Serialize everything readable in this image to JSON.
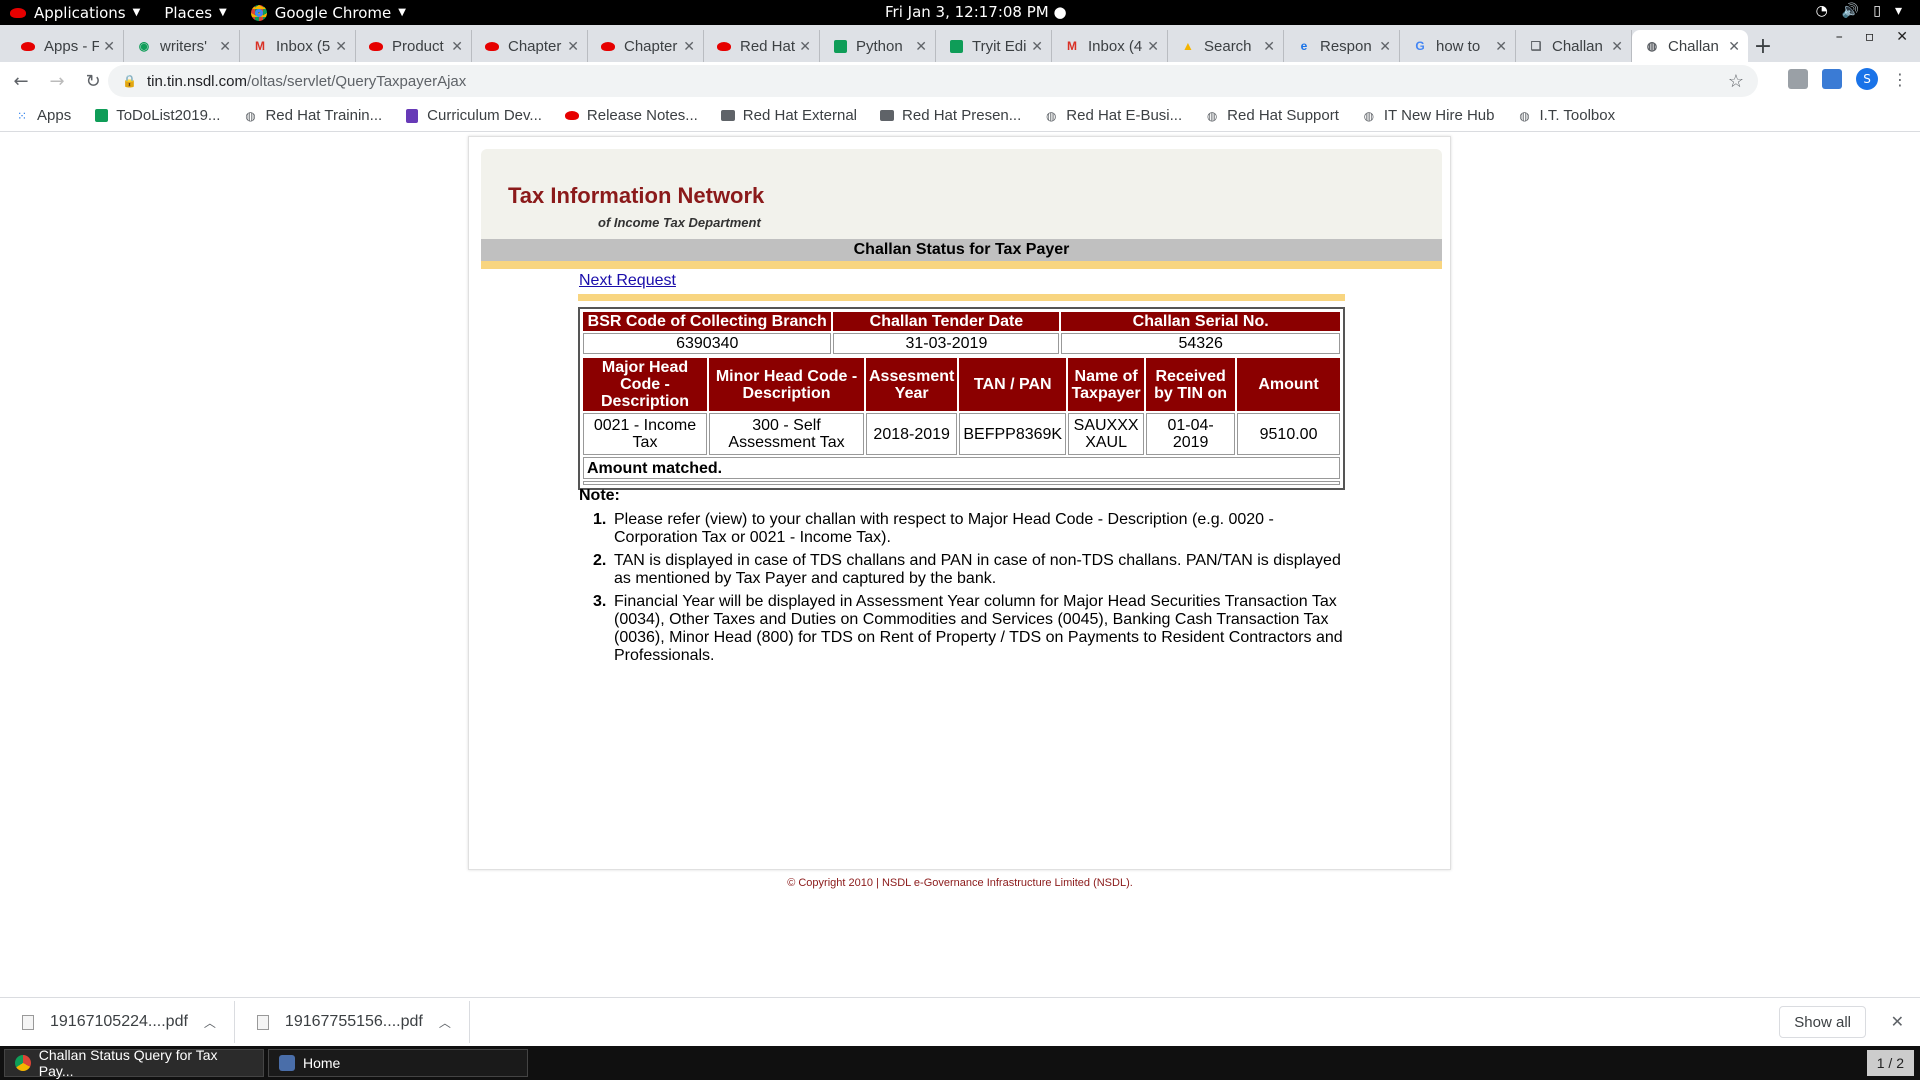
{
  "system_bar": {
    "applications": "Applications",
    "places": "Places",
    "browser": "Google Chrome",
    "clock": "Fri Jan  3, 12:17:08 PM"
  },
  "tabs": [
    {
      "label": "Apps - F",
      "icon": "redhat-icon"
    },
    {
      "label": "writers'",
      "icon": "location-icon"
    },
    {
      "label": "Inbox (5",
      "icon": "gmail-icon"
    },
    {
      "label": "Product",
      "icon": "redhat-icon"
    },
    {
      "label": "Chapter",
      "icon": "redhat-icon"
    },
    {
      "label": "Chapter",
      "icon": "redhat-icon"
    },
    {
      "label": "Red Hat",
      "icon": "redhat-icon"
    },
    {
      "label": "Python",
      "icon": "sheets-icon"
    },
    {
      "label": "Tryit Edi",
      "icon": "sheets-icon"
    },
    {
      "label": "Inbox (4",
      "icon": "gmail-icon"
    },
    {
      "label": "Search",
      "icon": "drive-icon"
    },
    {
      "label": "Respon",
      "icon": "edge-icon"
    },
    {
      "label": "how to",
      "icon": "google-icon"
    },
    {
      "label": "Challan",
      "icon": "page-icon"
    },
    {
      "label": "Challan",
      "icon": "globe-icon",
      "active": true
    }
  ],
  "address_bar": {
    "domain": "tin.tin.nsdl.com",
    "path": "/oltas/servlet/QueryTaxpayerAjax"
  },
  "bookmarks": [
    {
      "label": "Apps",
      "icon": "apps-grid-icon"
    },
    {
      "label": "ToDoList2019...",
      "icon": "sheets-icon"
    },
    {
      "label": "Red Hat Trainin...",
      "icon": "globe-icon"
    },
    {
      "label": "Curriculum Dev...",
      "icon": "doc-icon"
    },
    {
      "label": "Release Notes...",
      "icon": "redhat-icon"
    },
    {
      "label": "Red Hat External",
      "icon": "folder-icon"
    },
    {
      "label": "Red Hat Presen...",
      "icon": "folder-icon"
    },
    {
      "label": "Red Hat E-Busi...",
      "icon": "globe-icon"
    },
    {
      "label": "Red Hat Support",
      "icon": "globe-icon"
    },
    {
      "label": "IT New Hire Hub",
      "icon": "globe-icon"
    },
    {
      "label": "I.T. Toolbox",
      "icon": "globe-icon"
    }
  ],
  "page": {
    "brand_title": "Tax Information Network",
    "brand_subtitle": "of Income Tax Department",
    "section_title": "Challan Status for Tax Payer",
    "next_request": "Next Request",
    "table1": {
      "headers": [
        "BSR Code of Collecting Branch",
        "Challan Tender Date",
        "Challan Serial No."
      ],
      "row": [
        "6390340",
        "31-03-2019",
        "54326"
      ]
    },
    "table2": {
      "headers": [
        "Major Head Code - Description",
        "Minor Head Code - Description",
        "Assesment Year",
        "TAN / PAN",
        "Name of Taxpayer",
        "Received by TIN on",
        "Amount"
      ],
      "row": [
        "0021 - Income Tax",
        "300 - Self Assessment Tax",
        "2018-2019",
        "BEFPP8369K",
        "SAUXXX XAUL",
        "01-04-2019",
        "9510.00"
      ],
      "message": "Amount matched."
    },
    "note_title": "Note:",
    "notes": [
      {
        "num": "1.",
        "text": "Please refer (view) to your challan with respect to Major Head Code - Description (e.g. 0020 - Corporation Tax or 0021 - Income Tax)."
      },
      {
        "num": "2.",
        "text": "TAN is displayed in case of TDS challans and PAN in case of non-TDS challans. PAN/TAN is displayed as mentioned by Tax Payer and captured by the bank."
      },
      {
        "num": "3.",
        "text": "Financial Year will be displayed in Assessment Year column for Major Head Securities Transaction Tax (0034), Other Taxes and Duties on Commodities and Services (0045), Banking Cash Transaction Tax (0036), Minor Head (800) for TDS on Rent of Property / TDS on Payments to Resident Contractors and Professionals."
      }
    ],
    "copyright": "© Copyright 2010  |  NSDL e-Governance Infrastructure Limited (NSDL)."
  },
  "downloads": {
    "items": [
      "19167105224....pdf",
      "19167755156....pdf"
    ],
    "show_all": "Show all"
  },
  "taskbar": {
    "items": [
      "Challan Status Query for Tax Pay...",
      "Home"
    ],
    "workspace": "1 / 2"
  },
  "colors": {
    "brand": "#8b1a1a",
    "header_cell": "#8b0000",
    "accent_yellow": "#f8d580"
  }
}
